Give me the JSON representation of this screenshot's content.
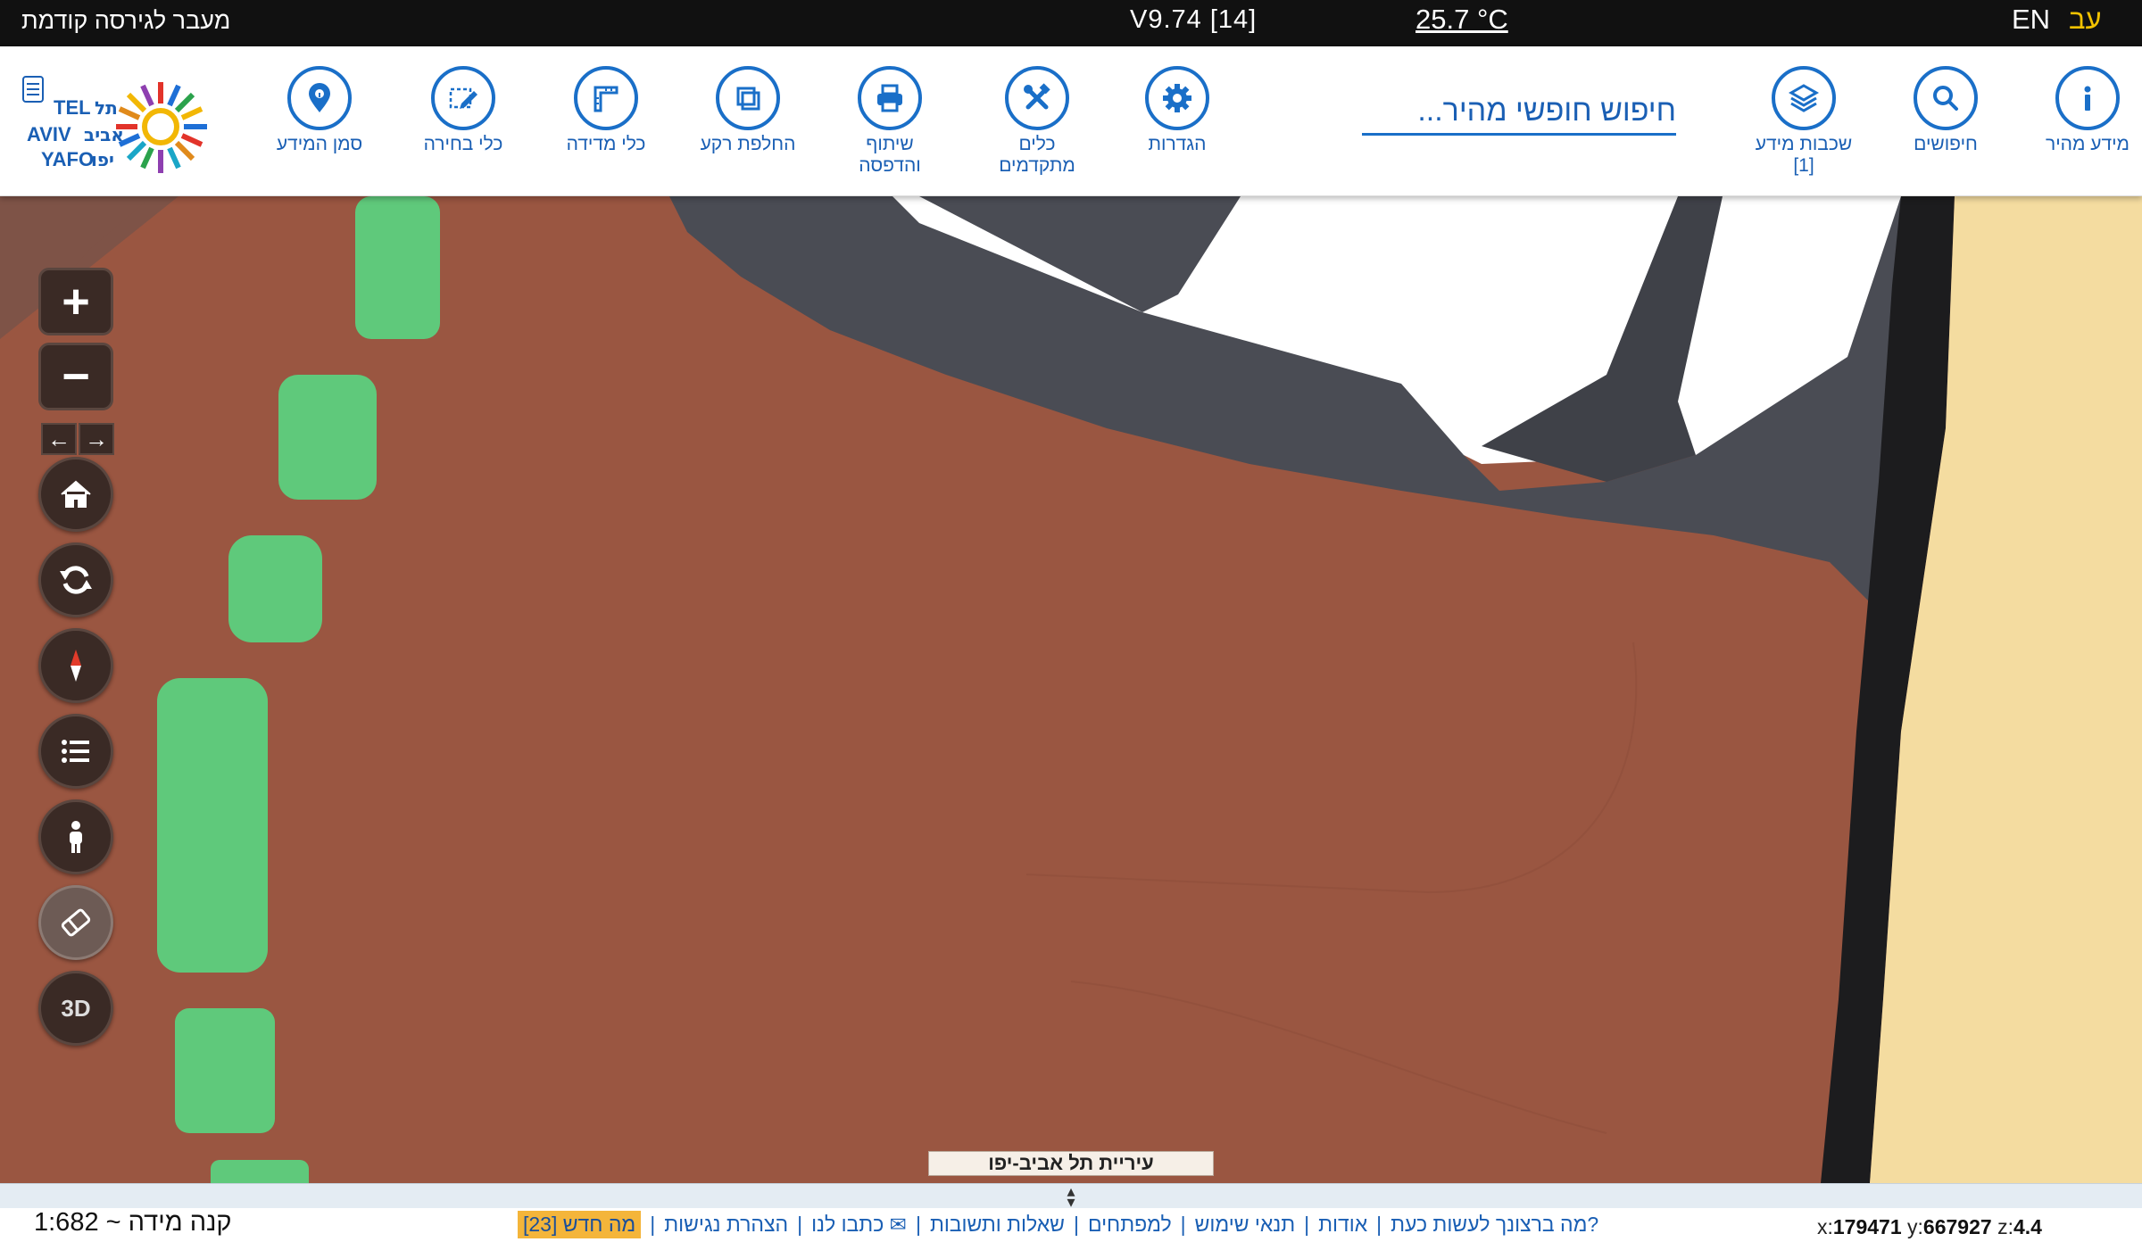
{
  "topbar": {
    "prev_version": "מעבר לגירסה קודמת",
    "version": "V9.74 [14]",
    "temperature": "25.7 °C",
    "lang_en": "EN",
    "lang_he": "עב"
  },
  "toolbar": {
    "tools": [
      {
        "label": "מידע מהיר",
        "label2": "",
        "icon": "info-icon"
      },
      {
        "label": "חיפושים",
        "label2": "",
        "icon": "search-icon"
      },
      {
        "label": "שכבות מידע",
        "label2": "[1]",
        "icon": "layers-icon"
      },
      {
        "label": "הגדרות",
        "label2": "",
        "icon": "gear-icon"
      },
      {
        "label": "כלים",
        "label2": "מתקדמים",
        "icon": "tools-icon"
      },
      {
        "label": "שיתוף",
        "label2": "והדפסה",
        "icon": "printer-icon"
      },
      {
        "label": "החלפת רקע",
        "label2": "",
        "icon": "basemap-icon"
      },
      {
        "label": "כלי מדידה",
        "label2": "",
        "icon": "ruler-icon"
      },
      {
        "label": "כלי בחירה",
        "label2": "",
        "icon": "select-icon"
      },
      {
        "label": "סמן המידע",
        "label2": "",
        "icon": "pin-icon"
      }
    ],
    "search_placeholder": "חיפוש חופשי מהיר...",
    "logo_text": [
      "TEL",
      "AVIV",
      "YAFO",
      "תל",
      "אביב",
      "יפו"
    ]
  },
  "map": {
    "controls": [
      "arrow-left-icon",
      "arrow-right-icon",
      "zoom-in-icon",
      "zoom-out-icon",
      "home-icon",
      "refresh-icon",
      "compass-icon",
      "legend-list-icon",
      "street-view-icon",
      "eraser-icon"
    ],
    "zoom_in": "+",
    "zoom_out": "−",
    "arrow_left": "←",
    "arrow_right": "→",
    "threed_label": "3D",
    "city_label": "עיריית תל אביב-יפו",
    "colors": {
      "building": "#9a5641",
      "green": "#5fc97b",
      "road": "#4a4c54",
      "sand": "#f4dca0",
      "white": "#ffffff"
    }
  },
  "bottombar": {
    "scale": "קנה מידה ~ 1:682",
    "links": [
      "מה חדש [23]",
      "הצהרת נגישות",
      "כתבו לנו ✉",
      "שאלות ותשובות",
      "למפתחים",
      "תנאי שימוש",
      "אודות",
      "מה ברצונך לעשות כעת?"
    ],
    "coords": {
      "x_label": "x:",
      "x": "179471",
      "y_label": "y:",
      "y": "667927",
      "z_label": "z:",
      "z": "4.4"
    }
  }
}
